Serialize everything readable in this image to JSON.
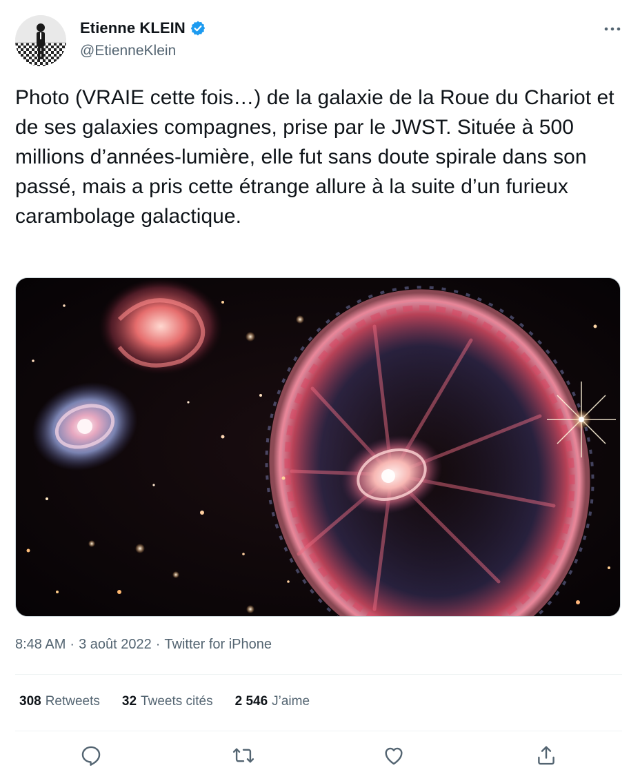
{
  "author": {
    "display_name": "Etienne KLEIN",
    "handle": "@EtienneKlein",
    "verified": true,
    "verified_color": "#1d9bf0"
  },
  "tweet": {
    "text": "Photo (VRAIE cette fois…) de la galaxie de la Roue du Chariot et de ses galaxies compagnes, prise par le JWST. Située à 500 millions d’années-lumière, elle fut sans doute spirale dans son passé, mais a pris cette étrange allure à la suite d’un furieux carambolage galactique."
  },
  "meta": {
    "time": "8:48 AM",
    "separator": "·",
    "date": "3 août 2022",
    "source": "Twitter for iPhone"
  },
  "stats": {
    "retweets_count": "308",
    "retweets_label": "Retweets",
    "quotes_count": "32",
    "quotes_label": "Tweets cités",
    "likes_count": "2 546",
    "likes_label": "J’aime"
  },
  "icons": {
    "more": "more-icon",
    "verified": "verified-badge-icon",
    "reply": "reply-icon",
    "retweet": "retweet-icon",
    "like": "like-icon",
    "share": "share-icon"
  },
  "colors": {
    "text_primary": "#0f1419",
    "text_secondary": "#536471",
    "divider": "#eff3f4"
  }
}
